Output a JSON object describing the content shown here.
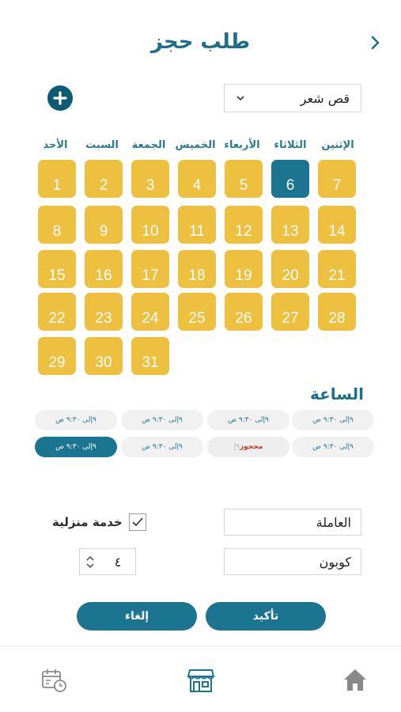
{
  "header": {
    "title": "طلب حجز"
  },
  "service_select": {
    "value": "قص شعر"
  },
  "weekdays": [
    "الإثنين",
    "الثلاثاء",
    "الأربعاء",
    "الخميس",
    "الجمعة",
    "السبت",
    "الأحد"
  ],
  "calendar": {
    "days": [
      "1",
      "2",
      "3",
      "4",
      "5",
      "6",
      "7",
      "8",
      "9",
      "10",
      "11",
      "12",
      "13",
      "14",
      "15",
      "16",
      "17",
      "18",
      "19",
      "20",
      "21",
      "22",
      "23",
      "24",
      "25",
      "26",
      "27",
      "28",
      "29",
      "30",
      "31"
    ],
    "selected_day": "6"
  },
  "hours": {
    "title": "الساعة",
    "slots": [
      {
        "text": "٩إلى ٩:٣٠ ص"
      },
      {
        "text": "٩إلى ٩:٣٠ ص"
      },
      {
        "text": "٩إلى ٩:٣٠ ص"
      },
      {
        "text": "٩إلى ٩:٣٠ ص"
      },
      {
        "text": "٩إلى ٩:٣٠ ص"
      },
      {
        "reserved_word": "محجوز",
        "reserved_rest": "٩إ"
      },
      {
        "text": "٩إلى ٩:٣٠ ص"
      },
      {
        "text": "٩إلى ٩:٣٠ ص"
      }
    ]
  },
  "form": {
    "worker_value": "العاملة",
    "coupon_value": "كوبون",
    "home_service_label": "خدمة منزلية",
    "home_service_checked": true,
    "quantity": "٤"
  },
  "actions": {
    "confirm_label": "تأكيد",
    "cancel_label": "إلغاء"
  },
  "colors": {
    "primary": "#1c7590",
    "day": "#eec03f",
    "title": "#1d6f89"
  },
  "bottom_nav": [
    "calendar-clock-icon",
    "store-icon",
    "home-icon"
  ]
}
